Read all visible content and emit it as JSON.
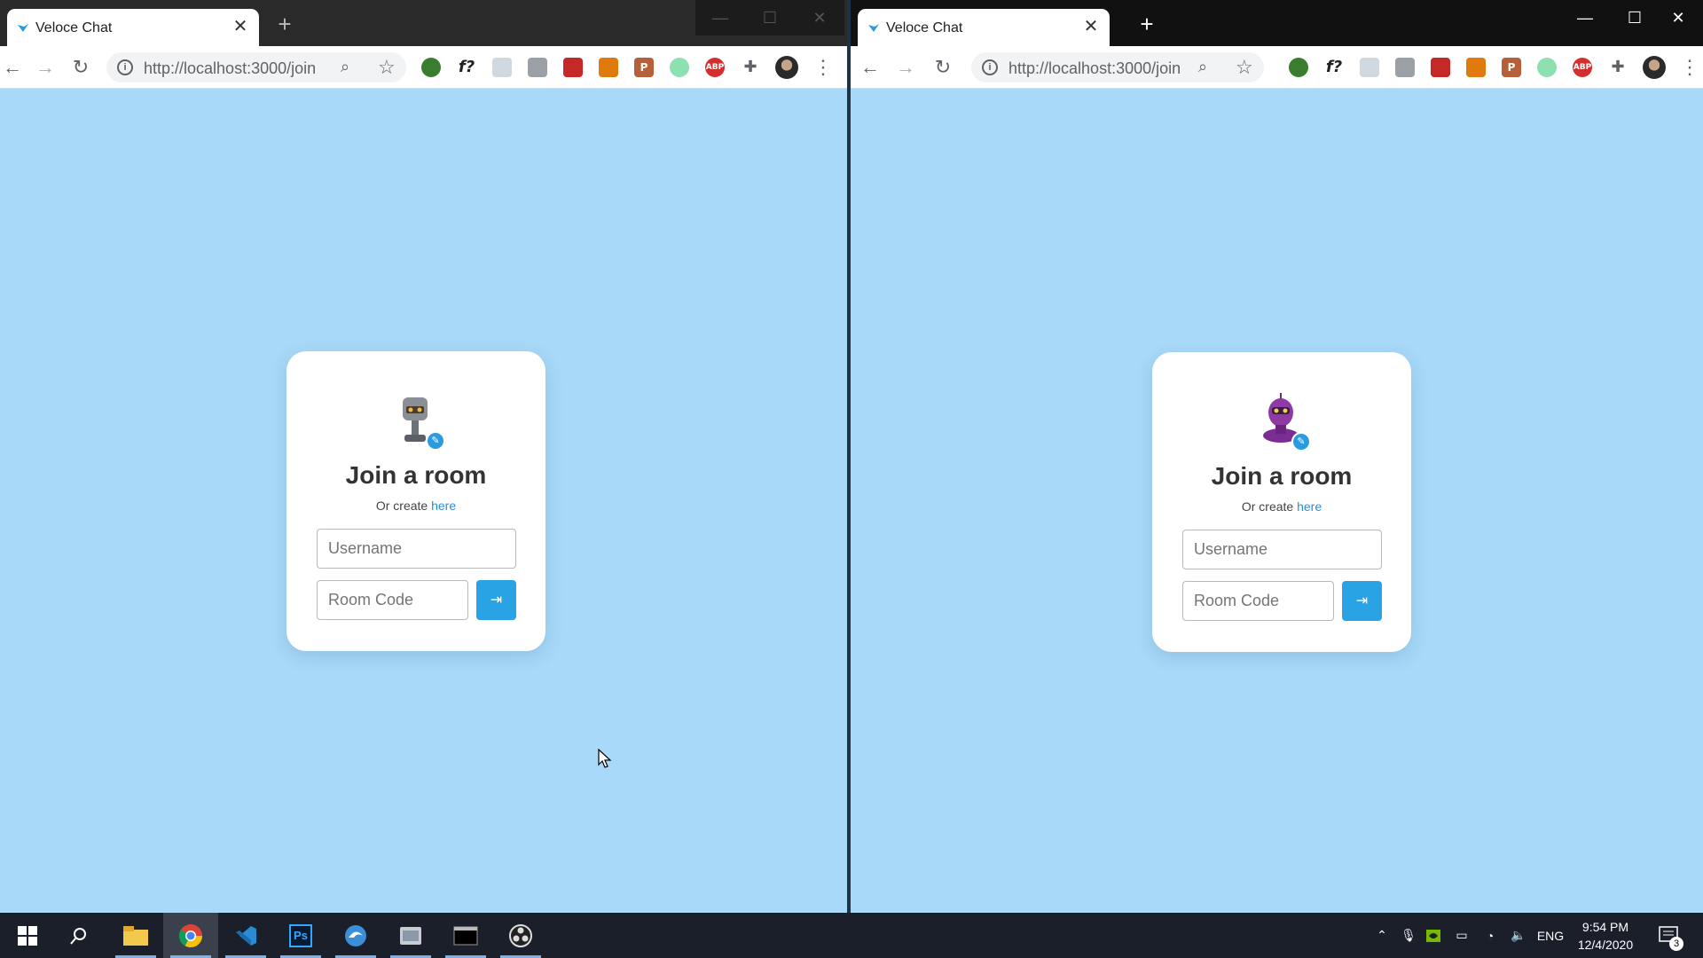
{
  "windows": [
    {
      "tab_title": "Veloce Chat",
      "url": "http://localhost:3000/join",
      "card": {
        "title": "Join a room",
        "subtitle_prefix": "Or create",
        "subtitle_link": "here",
        "username_placeholder": "Username",
        "roomcode_placeholder": "Room Code",
        "avatar": "gray-robot"
      }
    },
    {
      "tab_title": "Veloce Chat",
      "url": "http://localhost:3000/join",
      "card": {
        "title": "Join a room",
        "subtitle_prefix": "Or create",
        "subtitle_link": "here",
        "username_placeholder": "Username",
        "roomcode_placeholder": "Room Code",
        "avatar": "purple-robot"
      }
    }
  ],
  "extensions": [
    "globe-extension-icon",
    "fx-extension-icon",
    "pen-extension-icon",
    "camera-extension-icon",
    "red-square-extension-icon",
    "orange-extension-icon",
    "p-extension-icon",
    "green-circle-extension-icon",
    "adblock-extension-icon",
    "puzzle-extension-icon"
  ],
  "extension_labels": {
    "fx": "f?",
    "adblock": "ABP",
    "p": "P"
  },
  "taskbar": {
    "apps": [
      "start-icon",
      "search-icon",
      "file-explorer-icon",
      "chrome-icon",
      "vscode-icon",
      "photoshop-icon",
      "edge-icon",
      "app-icon",
      "terminal-icon",
      "obs-icon"
    ],
    "ps_label": "Ps",
    "language": "ENG",
    "time": "9:54 PM",
    "date": "12/4/2020",
    "notifications": "3"
  },
  "colors": {
    "page_bg": "#a8d9f8",
    "accent": "#29a3e4",
    "link": "#2b8fd6"
  }
}
